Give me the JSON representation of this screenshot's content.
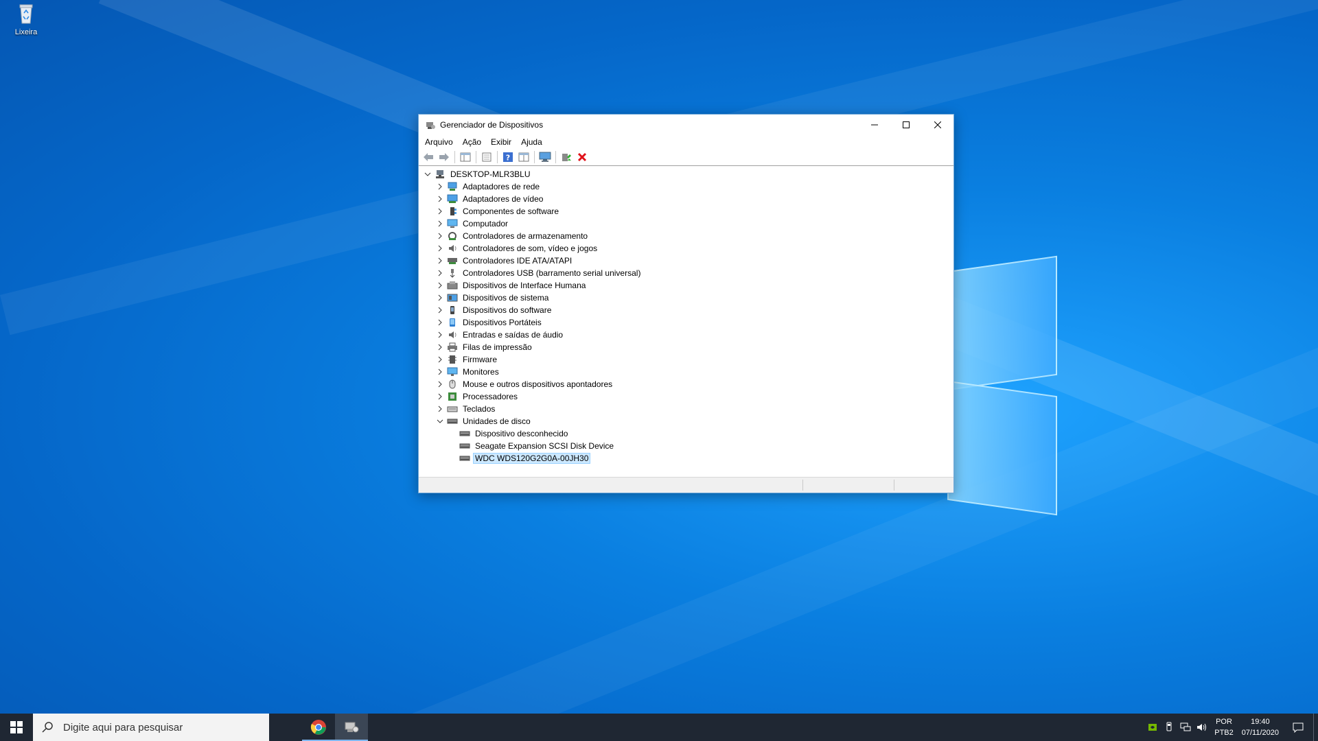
{
  "desktop": {
    "icons": [
      {
        "label": "Lixeira",
        "icon": "recycle-bin-icon"
      }
    ]
  },
  "window": {
    "title": "Gerenciador de Dispositivos",
    "menu": [
      "Arquivo",
      "Ação",
      "Exibir",
      "Ajuda"
    ],
    "toolbar_icons": [
      "back-arrow-icon",
      "forward-arrow-icon",
      "show-hide-console-tree-icon",
      "properties-icon",
      "help-icon",
      "view-pane-icon",
      "scan-hardware-icon",
      "update-driver-icon",
      "uninstall-device-icon"
    ],
    "tree": {
      "root": "DESKTOP-MLR3BLU",
      "categories": [
        "Adaptadores de rede",
        "Adaptadores de vídeo",
        "Componentes de software",
        "Computador",
        "Controladores de armazenamento",
        "Controladores de som, vídeo e jogos",
        "Controladores IDE ATA/ATAPI",
        "Controladores USB (barramento serial universal)",
        "Dispositivos de Interface Humana",
        "Dispositivos de sistema",
        "Dispositivos do software",
        "Dispositivos Portáteis",
        "Entradas e saídas de áudio",
        "Filas de impressão",
        "Firmware",
        "Monitores",
        "Mouse e outros dispositivos apontadores",
        "Processadores",
        "Teclados",
        "Unidades de disco"
      ],
      "disk_children": [
        "Dispositivo desconhecido",
        "Seagate Expansion SCSI Disk Device",
        "WDC WDS120G2G0A-00JH30"
      ],
      "selected": "WDC WDS120G2G0A-00JH30"
    }
  },
  "taskbar": {
    "search_placeholder": "Digite aqui para pesquisar",
    "apps": [
      "chrome-icon",
      "device-manager-icon"
    ],
    "language": {
      "line1": "POR",
      "line2": "PTB2"
    },
    "clock": {
      "time": "19:40",
      "date": "07/11/2020"
    }
  }
}
